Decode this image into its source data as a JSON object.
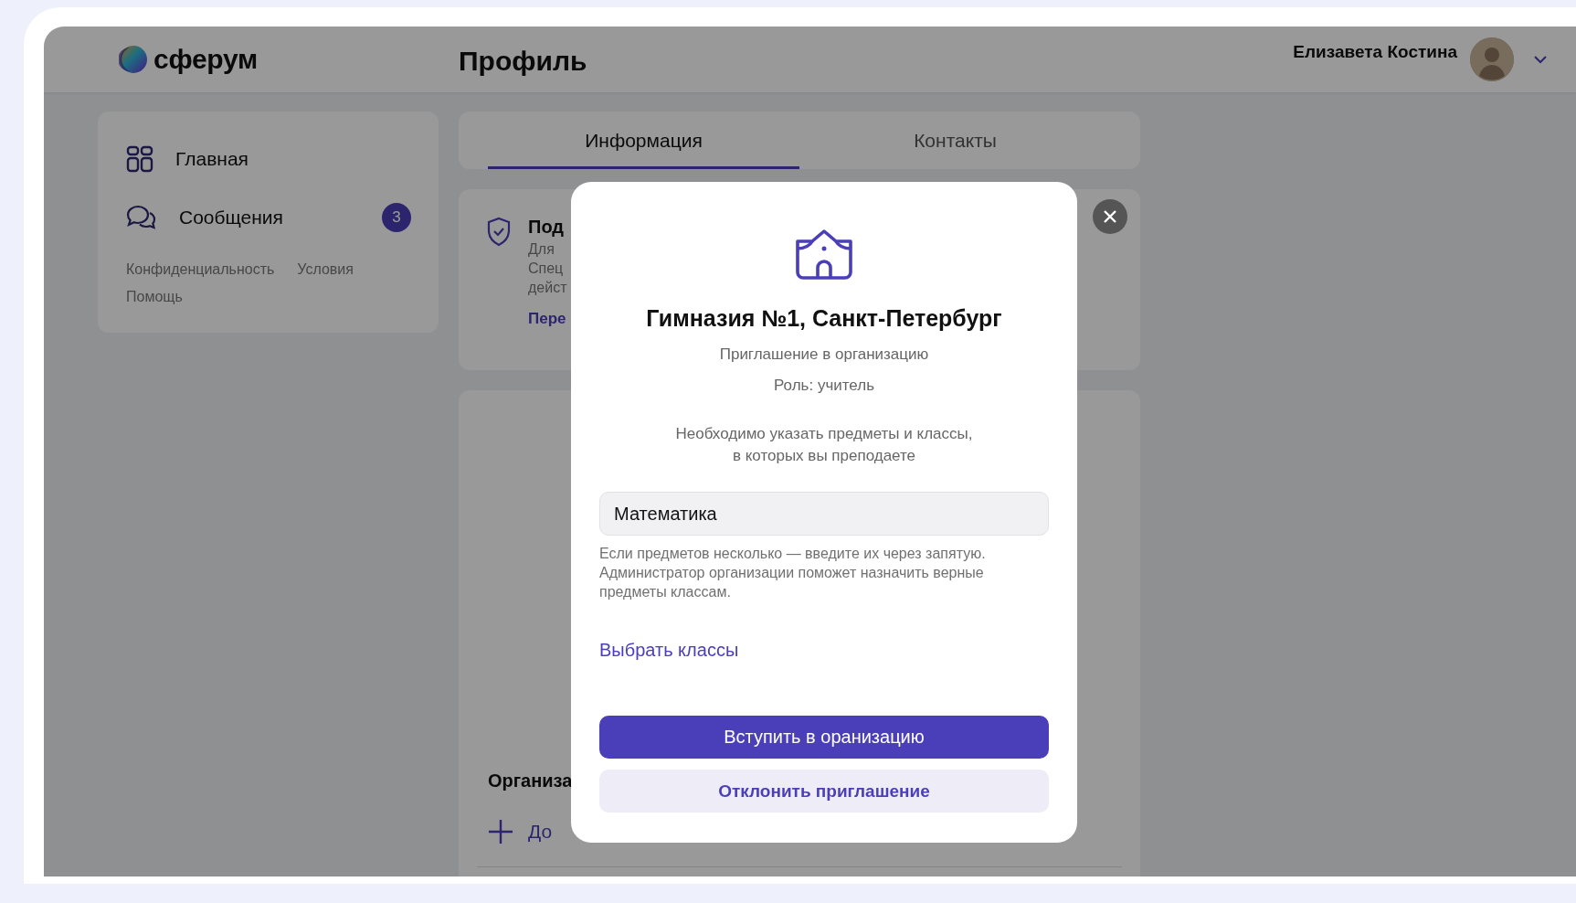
{
  "header": {
    "logo": "сферум",
    "title": "Профиль",
    "user_name": "Елизавета Костина"
  },
  "sidebar": {
    "items": [
      {
        "label": "Главная"
      },
      {
        "label": "Сообщения",
        "badge": "3"
      }
    ],
    "links": [
      "Конфиденциальность",
      "Условия",
      "Помощь"
    ]
  },
  "tabs": [
    {
      "label": "Информация",
      "selected": true
    },
    {
      "label": "Контакты",
      "selected": false
    }
  ],
  "verification_card": {
    "title": "Под",
    "lines": [
      "Для",
      "Спец",
      "дейст"
    ],
    "link": "Пере"
  },
  "organizations": {
    "title": "Организа",
    "add_label": "До"
  },
  "modal": {
    "name": "Гимназия №1, Санкт-Петербург",
    "subtitle": "Приглашение в организацию",
    "role": "Роль: учитель",
    "description": [
      "Необходимо указать предметы и классы,",
      "в которых вы преподаете"
    ],
    "subjects_field": {
      "value": "Математика"
    },
    "hint": "Если предметов несколько — введите их через запятую. Администратор организации поможет назначить верные предметы классам.",
    "link": "Выбрать классы",
    "primary_button": "Вступить в оранизацию",
    "secondary_button": "Отклонить приглашение"
  }
}
